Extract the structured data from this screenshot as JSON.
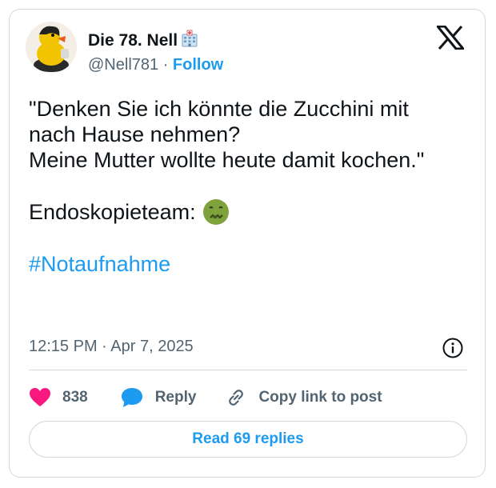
{
  "author": {
    "name": "Die 78. Nell",
    "handle": "@Nell781",
    "separator": "·",
    "follow_label": "Follow",
    "name_emoji": "hospital-icon"
  },
  "tweet": {
    "lines": [
      "\"Denken Sie ich könnte die Zucchini mit nach Hause nehmen?",
      "Meine Mutter wollte heute damit kochen.\"",
      "Endoskopieteam:"
    ],
    "reaction_emoji": "nauseated-face-icon",
    "hashtag": "#Notaufnahme",
    "timestamp": "12:15 PM · Apr 7, 2025"
  },
  "actions": {
    "like_count": "838",
    "reply_label": "Reply",
    "copy_label": "Copy link to post"
  },
  "read_replies_label": "Read 69 replies",
  "colors": {
    "accent": "#1d9bf0",
    "like": "#f91880",
    "text": "#0f1419",
    "secondary": "#536471",
    "border": "#cfd9de"
  }
}
